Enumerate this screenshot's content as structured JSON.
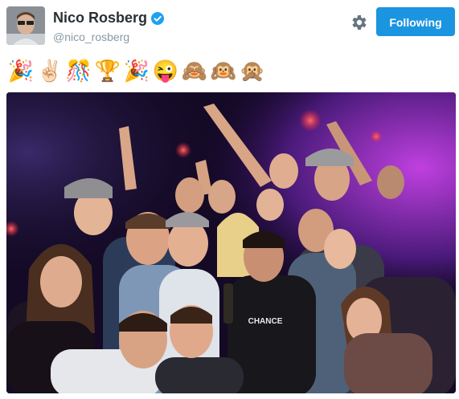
{
  "profile": {
    "display_name": "Nico Rosberg",
    "handle": "@nico_rosberg",
    "verified": true
  },
  "actions": {
    "follow_label": "Following"
  },
  "tweet": {
    "emojis": [
      "🎉",
      "✌🏻",
      "🎊",
      "🏆",
      "🎉",
      "😜",
      "🙈",
      "🙉",
      "🙊"
    ]
  },
  "colors": {
    "accent": "#1b95e0",
    "name": "#292f33",
    "handle": "#8899a6"
  },
  "icons": {
    "settings": "gear-icon",
    "verified": "verified-badge-icon"
  },
  "photo": {
    "shirt_text": "CHANCE"
  }
}
